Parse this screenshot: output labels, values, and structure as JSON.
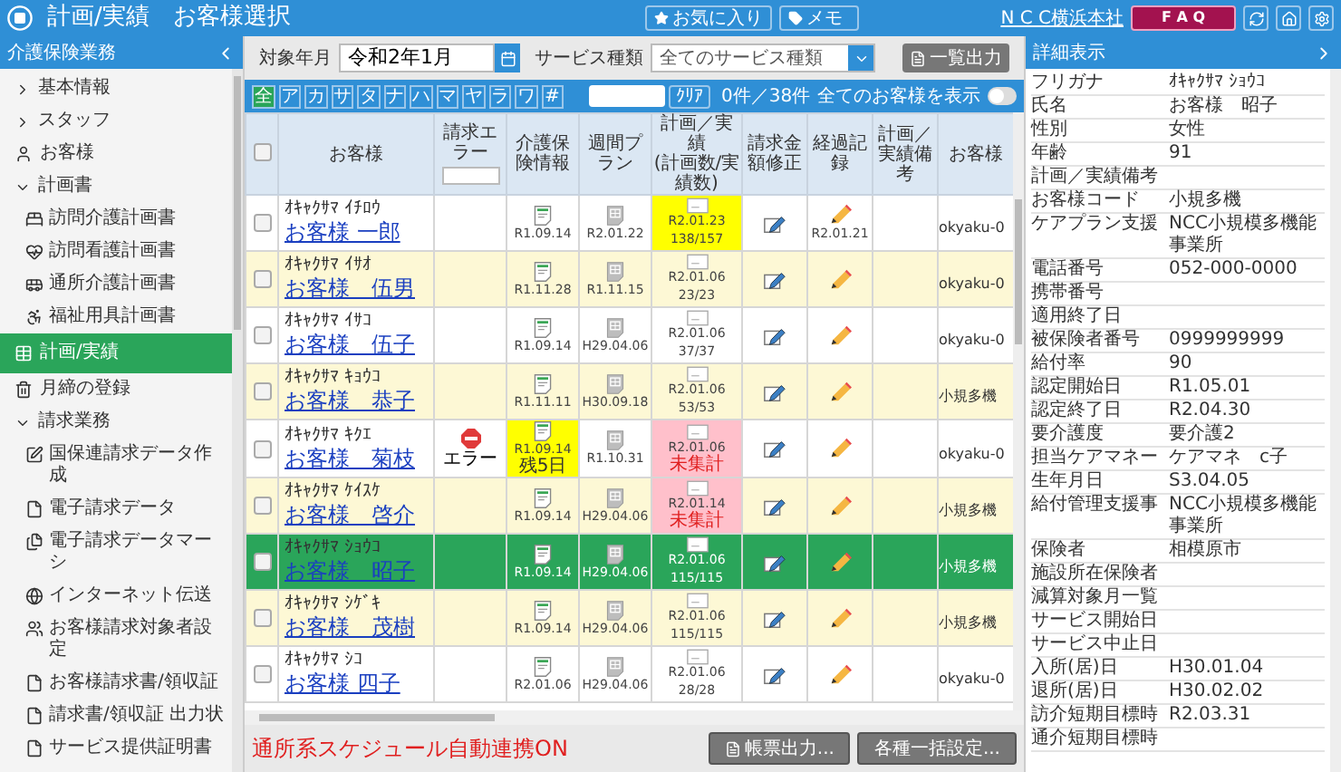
{
  "header": {
    "title": "計画/実績　お客様選択",
    "favorites": "お気に入り",
    "memo": "メモ",
    "office": "N C C横浜本社",
    "faq": "F A Q"
  },
  "sidebar": {
    "title": "介護保険業務",
    "items": [
      {
        "label": "基本情報",
        "kind": "group",
        "expanded": false,
        "selected": false
      },
      {
        "label": "スタッフ",
        "kind": "group",
        "expanded": false,
        "selected": false
      },
      {
        "label": "お客様",
        "kind": "link",
        "selected": false
      },
      {
        "label": "計画書",
        "kind": "group",
        "expanded": true,
        "selected": false,
        "children": [
          {
            "label": "訪問介護計画書",
            "selected": false
          },
          {
            "label": "訪問看護計画書",
            "selected": false
          },
          {
            "label": "通所介護計画書",
            "selected": false
          },
          {
            "label": "福祉用具計画書",
            "selected": false
          }
        ]
      },
      {
        "label": "計画/実績",
        "kind": "link",
        "selected": true
      },
      {
        "label": "月締の登録",
        "kind": "link",
        "selected": false
      },
      {
        "label": "請求業務",
        "kind": "group",
        "expanded": true,
        "selected": false,
        "children": [
          {
            "label": "国保連請求データ作成",
            "selected": false
          },
          {
            "label": "電子請求データ",
            "selected": false
          },
          {
            "label": "電子請求データマーシ",
            "selected": false
          },
          {
            "label": "インターネット伝送",
            "selected": false
          },
          {
            "label": "お客様請求対象者設定",
            "selected": false
          },
          {
            "label": "お客様請求書/領収証",
            "selected": false
          },
          {
            "label": "請求書/領収証 出力状",
            "selected": false
          },
          {
            "label": "サービス提供証明書",
            "selected": false
          }
        ]
      }
    ]
  },
  "filters": {
    "month_label": "対象年月",
    "month": "令和2年1月",
    "service_label": "サービス種類",
    "service": "全てのサービス種類",
    "export": "一覧出力"
  },
  "kana_filter": {
    "letters": [
      {
        "label": "全",
        "selected": true
      },
      {
        "label": "ア",
        "selected": false
      },
      {
        "label": "カ",
        "selected": false
      },
      {
        "label": "サ",
        "selected": false
      },
      {
        "label": "タ",
        "selected": false
      },
      {
        "label": "ナ",
        "selected": false
      },
      {
        "label": "ハ",
        "selected": false
      },
      {
        "label": "マ",
        "selected": false
      },
      {
        "label": "ヤ",
        "selected": false
      },
      {
        "label": "ラ",
        "selected": false
      },
      {
        "label": "ワ",
        "selected": false
      },
      {
        "label": "#",
        "selected": false
      }
    ],
    "clear": "ｸﾘｱ",
    "count": "0件／38件",
    "show_all": {
      "label": "全てのお客様を表示",
      "on": false
    }
  },
  "table": {
    "select_all_checked": false,
    "columns": [
      "お客様",
      "請求エラー",
      "介護保険情報",
      "週間プラン",
      "計画／実績",
      "請求金額修正",
      "経過記録",
      "計画／実績備考",
      "お客様"
    ],
    "plan_subheading": "(計画数/実績数)",
    "rows": [
      {
        "kana": "ｵｷｬｸｻﾏ ｲﾁﾛｳ",
        "name": "お客様 一郎",
        "checked": false,
        "selected": false,
        "insurance": {
          "date": "R1.09.14",
          "expiring": false
        },
        "weekly": "R2.01.22",
        "plan": {
          "date": "R2.01.23",
          "count": "138/157",
          "attention": true,
          "unsummed": false
        },
        "record_date": "R2.01.21",
        "code": "okyaku-0"
      },
      {
        "kana": "ｵｷｬｸｻﾏ ｲｻｵ",
        "name": "お客様　伍男",
        "checked": false,
        "selected": false,
        "insurance": {
          "date": "R1.11.28",
          "expiring": false
        },
        "weekly": "R1.11.15",
        "plan": {
          "date": "R2.01.06",
          "count": "23/23",
          "attention": false,
          "unsummed": false
        },
        "code": "okyaku-0"
      },
      {
        "kana": "ｵｷｬｸｻﾏ ｲｻｺ",
        "name": "お客様　伍子",
        "checked": false,
        "selected": false,
        "insurance": {
          "date": "R1.09.14",
          "expiring": false
        },
        "weekly": "H29.04.06",
        "plan": {
          "date": "R2.01.06",
          "count": "37/37",
          "attention": false,
          "unsummed": false
        },
        "code": "okyaku-0"
      },
      {
        "kana": "ｵｷｬｸｻﾏ ｷｮｳｺ",
        "name": "お客様　恭子",
        "checked": false,
        "selected": false,
        "insurance": {
          "date": "R1.11.11",
          "expiring": false
        },
        "weekly": "H30.09.18",
        "plan": {
          "date": "R2.01.06",
          "count": "53/53",
          "attention": false,
          "unsummed": false
        },
        "code": "小規多機"
      },
      {
        "kana": "ｵｷｬｸｻﾏ ｷｸｴ",
        "name": "お客様　菊枝",
        "checked": false,
        "selected": false,
        "error": "エラー",
        "insurance": {
          "date": "R1.09.14",
          "remaining": "残5日",
          "expiring": true
        },
        "weekly": "R1.10.31",
        "plan": {
          "date": "R2.01.06",
          "count": "未集計",
          "attention": false,
          "unsummed": true
        },
        "code": "okyaku-0"
      },
      {
        "kana": "ｵｷｬｸｻﾏ ｹｲｽｹ",
        "name": "お客様　啓介",
        "checked": false,
        "selected": false,
        "insurance": {
          "date": "R1.09.14",
          "expiring": false
        },
        "weekly": "H29.04.06",
        "plan": {
          "date": "R2.01.14",
          "count": "未集計",
          "attention": false,
          "unsummed": true
        },
        "code": "小規多機"
      },
      {
        "kana": "ｵｷｬｸｻﾏ ｼｮｳｺ",
        "name": "お客様　昭子",
        "checked": false,
        "selected": true,
        "insurance": {
          "date": "R1.09.14",
          "expiring": false
        },
        "weekly": "H29.04.06",
        "plan": {
          "date": "R2.01.06",
          "count": "115/115",
          "attention": false,
          "unsummed": false
        },
        "code": "小規多機"
      },
      {
        "kana": "ｵｷｬｸｻﾏ ｼｹﾞｷ",
        "name": "お客様　茂樹",
        "checked": false,
        "selected": false,
        "insurance": {
          "date": "R1.09.14",
          "expiring": false
        },
        "weekly": "H29.04.06",
        "plan": {
          "date": "R2.01.06",
          "count": "115/115",
          "attention": false,
          "unsummed": false
        },
        "code": "小規多機"
      },
      {
        "kana": "ｵｷｬｸｻﾏ ｼｺ",
        "name": "お客様 四子",
        "checked": false,
        "selected": false,
        "insurance": {
          "date": "R2.01.06",
          "expiring": false
        },
        "weekly": "H29.04.06",
        "plan": {
          "date": "R2.01.06",
          "count": "28/28",
          "attention": false,
          "unsummed": false
        },
        "code": "okyaku-0"
      }
    ]
  },
  "footer": {
    "notice": "通所系スケジュール自動連携ON",
    "buttons": [
      "帳票出力...",
      "各種一括設定..."
    ]
  },
  "detail": {
    "title": "詳細表示",
    "fields": [
      {
        "label": "フリガナ",
        "value": "ｵｷｬｸｻﾏ ｼｮｳｺ"
      },
      {
        "label": "氏名",
        "value": "お客様　昭子"
      },
      {
        "label": "性別",
        "value": "女性"
      },
      {
        "label": "年齢",
        "value": "91"
      },
      {
        "label": "計画／実績備考"
      },
      {
        "label": "お客様コード",
        "value": "小規多機"
      },
      {
        "label": "ケアプラン支援",
        "value": "NCC小規模多機能事業所"
      },
      {
        "label": "電話番号",
        "value": "052-000-0000"
      },
      {
        "label": "携帯番号"
      },
      {
        "label": "適用終了日"
      },
      {
        "label": "被保険者番号",
        "value": "0999999999"
      },
      {
        "label": "給付率",
        "value": "90"
      },
      {
        "label": "認定開始日",
        "value": "R1.05.01"
      },
      {
        "label": "認定終了日",
        "value": "R2.04.30"
      },
      {
        "label": "要介護度",
        "value": "要介護2"
      },
      {
        "label": "担当ケアマネー",
        "value": "ケアマネ　c子"
      },
      {
        "label": "生年月日",
        "value": "S3.04.05"
      },
      {
        "label": "給付管理支援事",
        "value": "NCC小規模多機能事業所"
      },
      {
        "label": "保険者",
        "value": "相模原市"
      },
      {
        "label": "施設所在保険者"
      },
      {
        "label": "減算対象月一覧"
      },
      {
        "label": "サービス開始日"
      },
      {
        "label": "サービス中止日"
      },
      {
        "label": "入所(居)日",
        "value": "H30.01.04"
      },
      {
        "label": "退所(居)日",
        "value": "H30.02.02"
      },
      {
        "label": "訪介短期目標時",
        "value": "R2.03.31"
      },
      {
        "label": "通介短期目標時"
      }
    ]
  }
}
